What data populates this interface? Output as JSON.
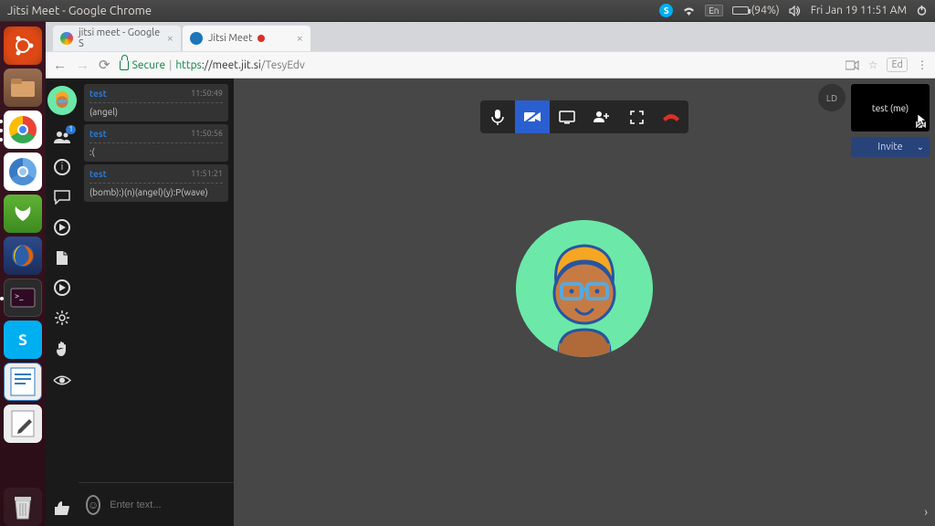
{
  "sysbar": {
    "title": "Jitsi Meet - Google Chrome",
    "lang": "En",
    "battery": "(94%)",
    "datetime": "Fri Jan 19 11:51 AM"
  },
  "tabs": [
    {
      "title": "jitsi meet - Google S"
    },
    {
      "title": "Jitsi Meet"
    }
  ],
  "addr": {
    "secure_label": "Secure",
    "https": "https",
    "host": "://meet.jit.si",
    "path": "/TesyEdv",
    "user_chip": "Ed"
  },
  "chat": {
    "badge_count": "1",
    "messages": [
      {
        "sender": "test",
        "body": "(angel)",
        "time": "11:50:49"
      },
      {
        "sender": "test",
        "body": ":(",
        "time": "11:50:56"
      },
      {
        "sender": "test",
        "body": "(bomb):)(n)(angel)(y):P(wave)",
        "time": "11:51:21"
      }
    ],
    "input_placeholder": "Enter text..."
  },
  "thumbs": {
    "initials": "LD",
    "self_label": "test (me)"
  },
  "invite_label": "Invite"
}
